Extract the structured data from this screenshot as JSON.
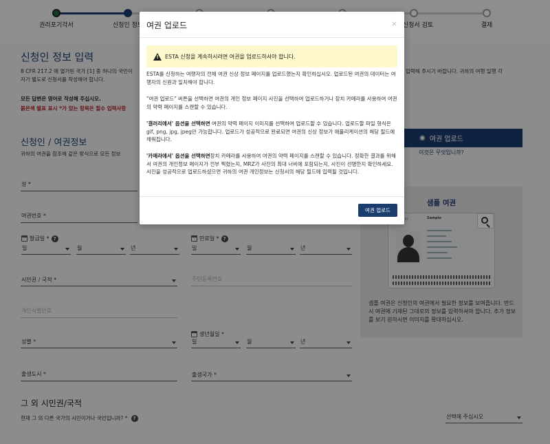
{
  "progress": {
    "steps": [
      "권리포기각서",
      "신청인 정보",
      "",
      "",
      "",
      "",
      "신청서 검토",
      "결제"
    ]
  },
  "page": {
    "title": "신청인 정보 입력",
    "intro_left": "8 CFR 217.2 에 열거된 국가 [1] 중 하나의 국민이",
    "intro_right": "입력해 주시기 바랍니다. 귀하의 여행 일행 각",
    "intro_line2": "자가 별도로 신청서를 작성해야 합니다.",
    "note_english": "모든 답변은 영어로 작성해 주십시오.",
    "note_required": "붉은색 별표 표시 *가 있는 항목은 필수 입력사항",
    "section_title": "신청인 / 여권정보",
    "section_sub": "귀하의 여권을 참조해 같은 방식으로 모든 정보",
    "fields": {
      "surname": "성 *",
      "passport_number": "여권번호 *",
      "issue_date": "발급일 *",
      "expiry_date": "만료일 *",
      "day": "일",
      "month": "월",
      "year": "년",
      "citizenship": "시민권 / 국적 *",
      "national_id": "주민등록번호",
      "personal_id": "개인식별번호",
      "gender": "성별 *",
      "birth_date": "생년월일 *",
      "birth_city": "출생도시 *",
      "birth_country": "출생국가 *"
    },
    "upload_button": "여권 업로드",
    "upload_link": "이것은 무엇입니까?",
    "sample": {
      "title": "샘플 여권",
      "card_label": "Sample",
      "card_type": "PASSPORT",
      "description": "샘플 여권은 신청인의 여권에서 필요한 정보를 보여줍니다. 반드시 여권에 기재된 그대로의 정보를 입력하셔야 합니다. 추가 정보를 보기 원하시면 이미지를 확대하십시오."
    },
    "other_citizenship_title": "그 외 시민권/국적",
    "other_citizenship_question": "현재 그 외 다른 국가의 시민이거나 국민입니까? *",
    "select_placeholder": "선택해 주십시오"
  },
  "modal": {
    "title": "여권 업로드",
    "close": "×",
    "warning": "ESTA 신청을 계속하시려면 여권을 업로드하셔야 합니다.",
    "p1": "ESTA를 신청하는 여행자의 전체 여권 신상 정보 페이지를 업로드했는지 확인하십시오. 업로드된 여권의 데이터는 여행자의 신원과 일치해야 합니다.",
    "p2": "\"여권 업로드\" 버튼을 선택하면 여권의 개인 정보 페이지 사진을 선택하여 업로드하거나 장치 카메라를 사용하여 여권의 약력 페이지를 스캔할 수 있습니다.",
    "p3_bold": "'갤러리에서' 옵션을 선택하면",
    "p3": " 여권의 약력 페이지 이미지를 선택하여 업로드할 수 있습니다. 업로드할 파일 형식은 gif, png, jpg, jpeg만 가능합니다. 업로드가 성공적으로 완료되면 여권의 신상 정보가 애플리케이션의 해당 필드에 채워집니다.",
    "p4_bold": "'카메라에서' 옵션을 선택하면",
    "p4": "장치 카메라를 사용하여 여권의 약력 페이지를 스캔할 수 있습니다. 정확한 결과를 위해서 여권의 개인정보 페이지가 전부 찍혔는지, MRZ가 사진의 최대 너비에 포함되는지, 사진이 선명한지 확인하세요. 사진을 성공적으로 업로드하셨으면 귀하의 여권 개인정보는 신청서의 해당 필드에 입력될 것입니다.",
    "upload_button": "여권 업로드"
  },
  "colors": {
    "primary": "#1a3d6e",
    "required": "#b21f24",
    "warning_bg": "#fdf9cc"
  }
}
